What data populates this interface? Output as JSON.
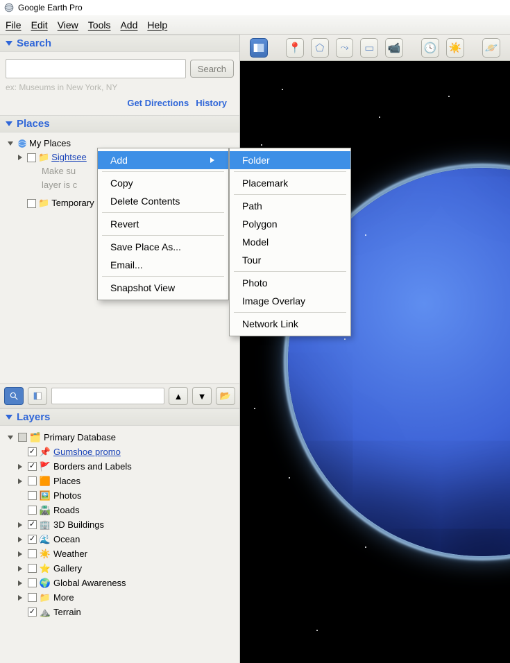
{
  "window": {
    "title": "Google Earth Pro"
  },
  "menubar": [
    "File",
    "Edit",
    "View",
    "Tools",
    "Add",
    "Help"
  ],
  "search": {
    "header": "Search",
    "value": "",
    "button": "Search",
    "hint": "ex: Museums in New York, NY",
    "links": {
      "directions": "Get Directions",
      "history": "History"
    }
  },
  "places": {
    "header": "Places",
    "my_places": "My Places",
    "sightseeing_partial": "Sightsee",
    "note_line1": "Make su",
    "note_line2": "layer is c",
    "temporary": "Temporary"
  },
  "context_menu": {
    "items": [
      {
        "label": "Add",
        "submenu": true
      },
      {
        "label": "Copy"
      },
      {
        "label": "Delete Contents"
      },
      {
        "label": "Revert"
      },
      {
        "label": "Save Place As..."
      },
      {
        "label": "Email..."
      },
      {
        "label": "Snapshot View"
      }
    ]
  },
  "add_submenu": [
    "Folder",
    "Placemark",
    "Path",
    "Polygon",
    "Model",
    "Tour",
    "Photo",
    "Image Overlay",
    "Network Link"
  ],
  "layers": {
    "header": "Layers",
    "primary_db": "Primary Database",
    "items": [
      {
        "label": "Gumshoe promo",
        "checked": true,
        "link": true,
        "icon": "pin-yellow"
      },
      {
        "label": "Borders and Labels",
        "checked": true,
        "expandable": true,
        "icon": "flag"
      },
      {
        "label": "Places",
        "checked": false,
        "expandable": true,
        "icon": "place"
      },
      {
        "label": "Photos",
        "checked": false,
        "icon": "photo"
      },
      {
        "label": "Roads",
        "checked": false,
        "icon": "road"
      },
      {
        "label": "3D Buildings",
        "checked": true,
        "expandable": true,
        "icon": "building"
      },
      {
        "label": "Ocean",
        "checked": true,
        "expandable": true,
        "icon": "ocean"
      },
      {
        "label": "Weather",
        "checked": false,
        "expandable": true,
        "icon": "sun"
      },
      {
        "label": "Gallery",
        "checked": false,
        "expandable": true,
        "icon": "star"
      },
      {
        "label": "Global Awareness",
        "checked": false,
        "expandable": true,
        "icon": "globe"
      },
      {
        "label": "More",
        "checked": false,
        "expandable": true,
        "icon": "folder"
      },
      {
        "label": "Terrain",
        "checked": true,
        "icon": "terrain"
      }
    ]
  },
  "toolbar_icons": [
    "sidebar-toggle",
    "placemark",
    "polygon",
    "path",
    "image-overlay",
    "record-tour",
    "time",
    "sun",
    "planet"
  ]
}
